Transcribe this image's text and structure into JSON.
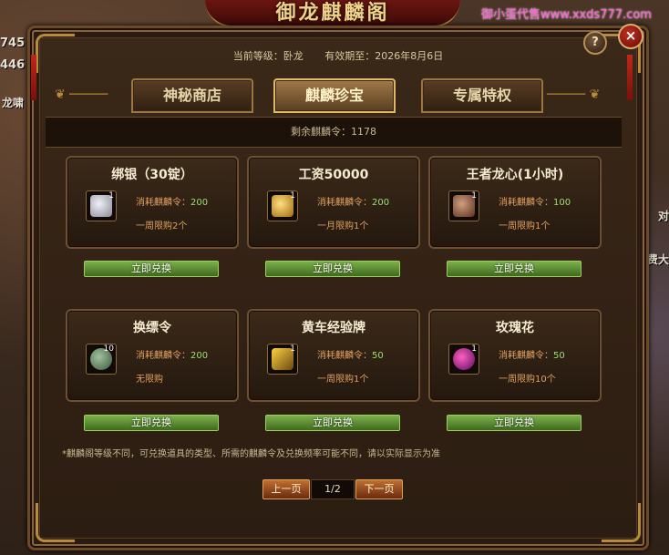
{
  "background": {
    "left_numbers": [
      "745",
      "446"
    ],
    "left_label": "龙啸",
    "right_labels": [
      "对",
      "费大"
    ],
    "watermark": "御小蛋代售www.xxds777.com"
  },
  "window": {
    "title": "御龙麒麟阁",
    "current_level_label": "当前等级：卧龙",
    "expiry_label": "有效期至：2026年8月6日",
    "help_label": "?",
    "close_label": "×"
  },
  "tabs": [
    {
      "label": "神秘商店",
      "active": false
    },
    {
      "label": "麒麟珍宝",
      "active": true
    },
    {
      "label": "专属特权",
      "active": false
    }
  ],
  "remaining_label": "剩余麒麟令：1178",
  "items": [
    {
      "name": "绑银（30锭）",
      "count": "1",
      "cost_label": "消耗麒麟令：",
      "cost": "200",
      "limit": "一周限购2个",
      "button": "立即兑换",
      "icon": "silver-ingot-icon",
      "color": "#c8c8d0"
    },
    {
      "name": "工资50000",
      "count": "1",
      "cost_label": "消耗麒麟令：",
      "cost": "200",
      "limit": "一月限购1个",
      "button": "立即兑换",
      "icon": "gold-coins-icon",
      "color": "#e0b040"
    },
    {
      "name": "王者龙心(1小时)",
      "count": "1",
      "cost_label": "消耗麒麟令：",
      "cost": "100",
      "limit": "一周限购1个",
      "button": "立即兑换",
      "icon": "dragon-heart-icon",
      "color": "#a07050"
    },
    {
      "name": "换缥令",
      "count": "10",
      "cost_label": "消耗麒麟令：",
      "cost": "200",
      "limit": "无限购",
      "button": "立即兑换",
      "icon": "jade-token-icon",
      "color": "#6a8a6a"
    },
    {
      "name": "黄车经验牌",
      "count": "1",
      "cost_label": "消耗麒麟令：",
      "cost": "50",
      "limit": "一周限购1个",
      "button": "立即兑换",
      "icon": "cart-plaque-icon",
      "color": "#c09020"
    },
    {
      "name": "玫瑰花",
      "count": "1",
      "cost_label": "消耗麒麟令：",
      "cost": "50",
      "limit": "一周限购10个",
      "button": "立即兑换",
      "icon": "rose-icon",
      "color": "#c02080"
    }
  ],
  "notice": "*麒麟阁等级不同，可兑换道具的类型、所需的麒麟令及兑换频率可能不同，请以实际显示为准",
  "pager": {
    "prev_label": "上一页",
    "page_text": "1/2",
    "next_label": "下一页"
  }
}
